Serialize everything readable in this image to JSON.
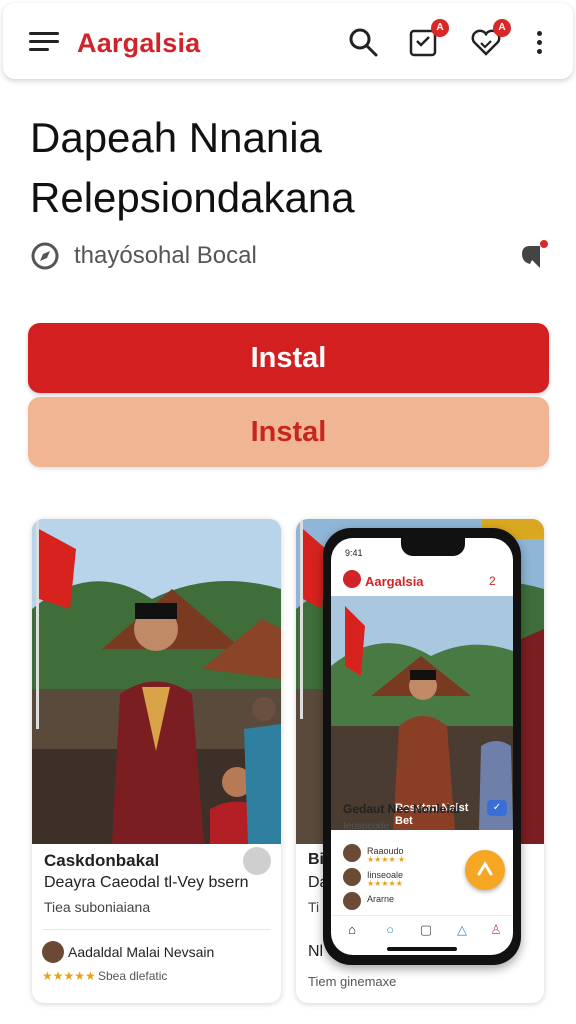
{
  "header": {
    "brand": "Aargalsia",
    "notif_badge": "A",
    "fav_badge": "A"
  },
  "title_line1": "Dapeah Nnania",
  "title_line2": "Relepsiondakana",
  "subtitle": "thayósohal Bocal",
  "buttons": {
    "primary": "Instal",
    "secondary": "Instal"
  },
  "card1": {
    "title": "Caskdonbakal",
    "line2": "Deayra Caeodal tl-Vey bsern",
    "line3": "Tiea suboniaiana",
    "author": "Aadaldal Malai Nevsain",
    "stars": "★★★★★",
    "rating": "Sbea dlefatic"
  },
  "card2": {
    "overlap_title": "Bi",
    "overlap_line2": "Da",
    "overlap_line3": "Ti",
    "overlap_author": "Nl",
    "bottom_line": "Tiem ginemaxe"
  },
  "phone": {
    "time": "9:41",
    "brand": "Aargalsia",
    "count": "2",
    "caption_line1": "Rosetan Nalst",
    "caption_line2": "Bet",
    "card_title": "Gedaut Nee Nonlelal",
    "card_sub": "Ieosocode",
    "row1_name": "Raaoudo",
    "row1_stars": "★★★★ ★",
    "row2_name": "Iinseoale",
    "row2_stars": "★★★★★",
    "row3_name": "Ararne"
  },
  "colors": {
    "brand_red": "#d0242a",
    "primary_button": "#d41f21",
    "secondary_button": "#f0b592",
    "fab": "#f5a623"
  }
}
